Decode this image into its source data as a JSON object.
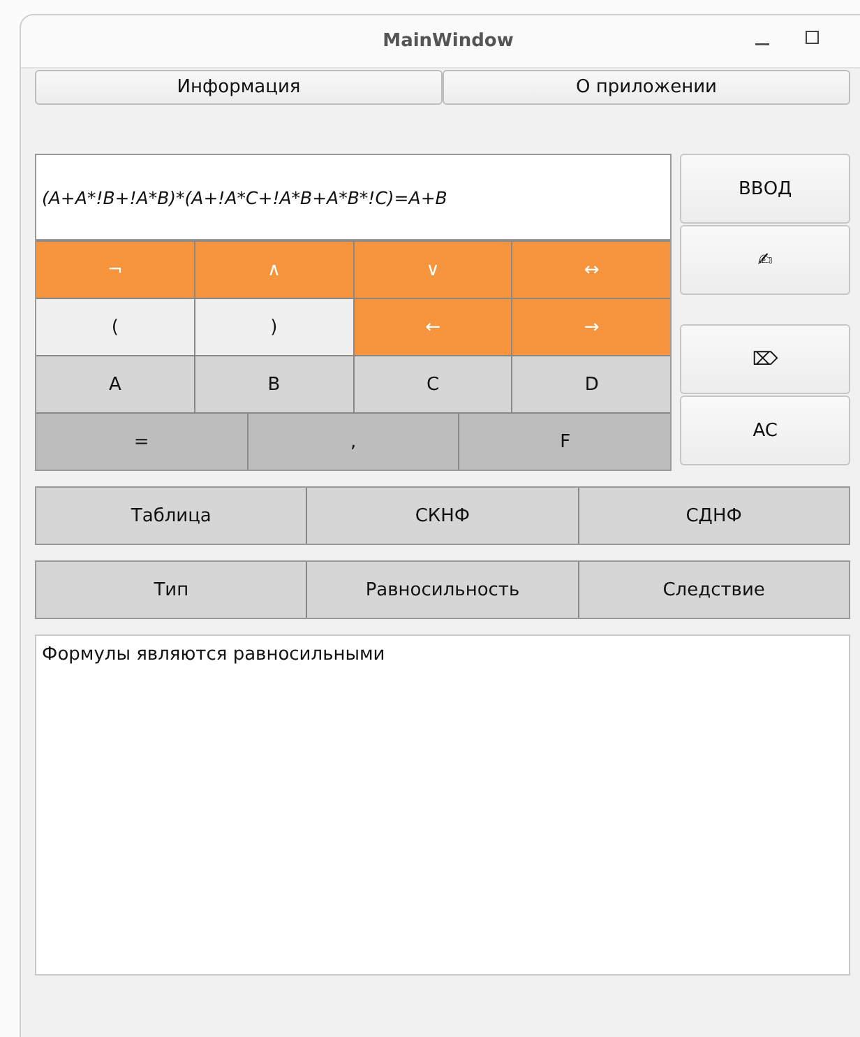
{
  "window": {
    "title": "MainWindow"
  },
  "menu": [
    "Информация",
    "О приложении"
  ],
  "display": {
    "value": "(A+A*!B+!A*B)*(A+!A*C+!A*B+A*B*!C)=A+B"
  },
  "keypad": [
    [
      {
        "label": "¬",
        "kind": "operator"
      },
      {
        "label": "∧",
        "kind": "operator"
      },
      {
        "label": "∨",
        "kind": "operator"
      },
      {
        "label": "↔",
        "kind": "operator"
      }
    ],
    [
      {
        "label": "(",
        "kind": "bracket"
      },
      {
        "label": ")",
        "kind": "bracket"
      },
      {
        "label": "←",
        "kind": "operator"
      },
      {
        "label": "→",
        "kind": "operator"
      }
    ],
    [
      {
        "label": "A",
        "kind": "variable"
      },
      {
        "label": "B",
        "kind": "variable"
      },
      {
        "label": "C",
        "kind": "variable"
      },
      {
        "label": "D",
        "kind": "variable"
      }
    ],
    [
      {
        "label": "=",
        "kind": "special"
      },
      {
        "label": ",",
        "kind": "special"
      },
      {
        "label": "F",
        "kind": "special"
      }
    ]
  ],
  "side_buttons": [
    [
      "ВВОД",
      "✍"
    ],
    [
      "⌦",
      "AC"
    ]
  ],
  "action_rows": [
    [
      "Таблица",
      "СКНФ",
      "СДНФ"
    ],
    [
      "Тип",
      "Равносильность",
      "Следствие"
    ]
  ],
  "output": "Формулы являются равносильными"
}
